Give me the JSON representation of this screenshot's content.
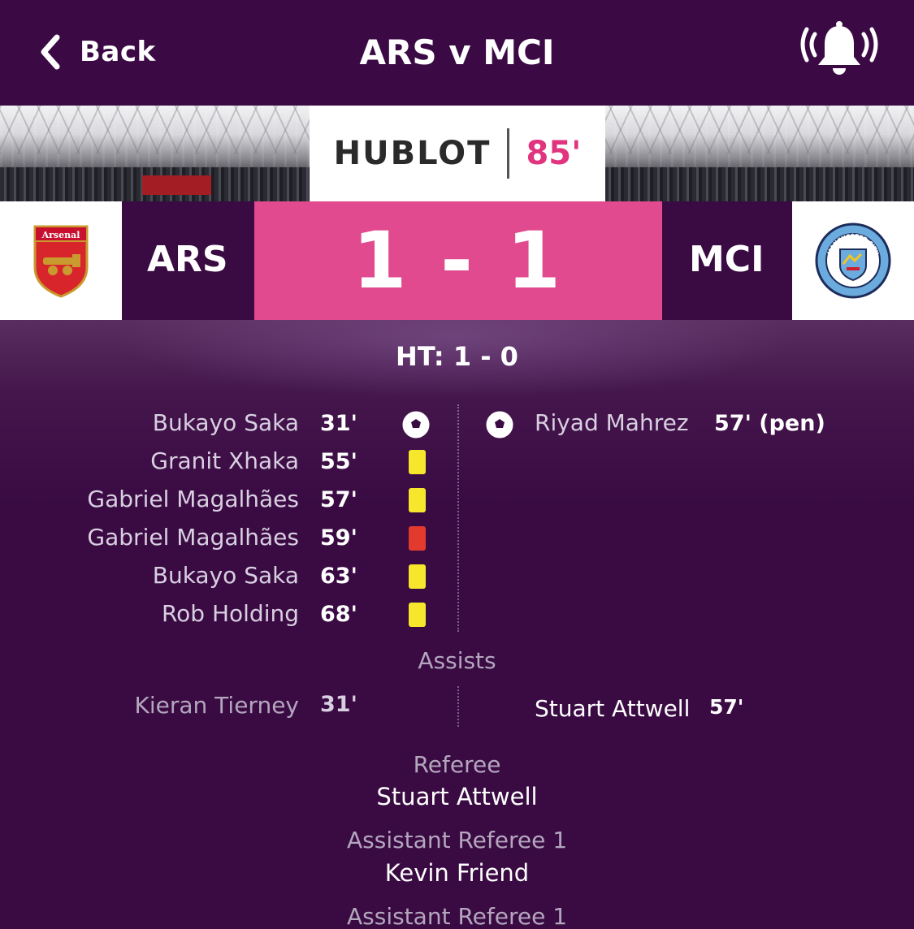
{
  "header": {
    "back_label": "Back",
    "title": "ARS v MCI",
    "notifications_icon": "bell-ringing-icon"
  },
  "banner": {
    "sponsor": "HUBLOT",
    "clock": "85'"
  },
  "score": {
    "home": {
      "code": "ARS",
      "crest_label": "Arsenal",
      "crest_icon": "arsenal-crest"
    },
    "away": {
      "code": "MCI",
      "crest_label": "MANCHESTER CITY",
      "crest_icon": "man-city-crest"
    },
    "score_text": "1 - 1",
    "halftime": "HT: 1 - 0"
  },
  "events": {
    "home": [
      {
        "player": "Bukayo Saka",
        "minute": "31'",
        "type": "goal",
        "icon": "football-icon"
      },
      {
        "player": "Granit Xhaka",
        "minute": "55'",
        "type": "yellow-card",
        "icon": "yellow-card-icon"
      },
      {
        "player": "Gabriel Magalhães",
        "minute": "57'",
        "type": "yellow-card",
        "icon": "yellow-card-icon"
      },
      {
        "player": "Gabriel Magalhães",
        "minute": "59'",
        "type": "red-card",
        "icon": "red-card-icon"
      },
      {
        "player": "Bukayo Saka",
        "minute": "63'",
        "type": "yellow-card",
        "icon": "yellow-card-icon"
      },
      {
        "player": "Rob Holding",
        "minute": "68'",
        "type": "yellow-card",
        "icon": "yellow-card-icon"
      }
    ],
    "away": [
      {
        "player": "Riyad Mahrez",
        "minute": "57' (pen)",
        "type": "goal",
        "icon": "football-icon"
      }
    ]
  },
  "assists": {
    "label": "Assists",
    "home": {
      "player": "Kieran Tierney",
      "minute": "31'"
    },
    "away": {
      "player": "Stuart Attwell",
      "minute": "57'"
    }
  },
  "officials": [
    {
      "role": "Referee",
      "name": "Stuart Attwell"
    },
    {
      "role": "Assistant Referee 1",
      "name": "Kevin Friend"
    },
    {
      "role": "Assistant Referee 1",
      "name": ""
    }
  ],
  "colors": {
    "background": "#3a0b43",
    "score_box": "#e14a8f",
    "clock": "#e0357e",
    "yellow_card": "#f6e72c",
    "red_card": "#e33a2e"
  }
}
